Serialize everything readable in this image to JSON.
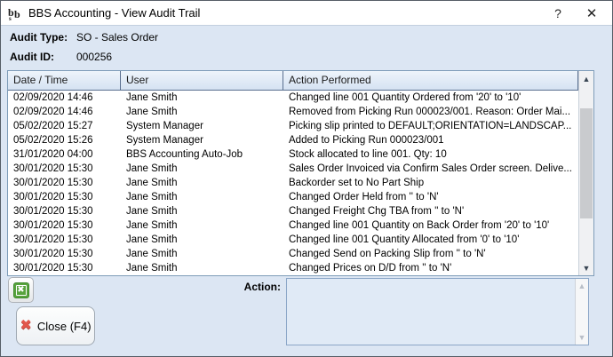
{
  "window": {
    "title": "BBS Accounting - View Audit Trail",
    "help_label": "?",
    "close_label": "✕"
  },
  "audit_info": {
    "type_label": "Audit Type:",
    "type_value": "SO - Sales Order",
    "id_label": "Audit ID:",
    "id_value": "000256"
  },
  "table": {
    "columns": [
      "Date / Time",
      "User",
      "Action Performed"
    ],
    "rows": [
      {
        "datetime": "02/09/2020 14:46",
        "user": "Jane Smith",
        "action": "Changed line 001 Quantity Ordered from '20' to '10'"
      },
      {
        "datetime": "02/09/2020 14:46",
        "user": "Jane Smith",
        "action": "Removed from Picking Run 000023/001. Reason: Order Mai..."
      },
      {
        "datetime": "05/02/2020 15:27",
        "user": "System Manager",
        "action": "Picking slip printed to DEFAULT;ORIENTATION=LANDSCAP..."
      },
      {
        "datetime": "05/02/2020 15:26",
        "user": "System Manager",
        "action": "Added to Picking Run 000023/001"
      },
      {
        "datetime": "31/01/2020 04:00",
        "user": "BBS Accounting Auto-Job",
        "action": "Stock allocated to line 001. Qty: 10"
      },
      {
        "datetime": "30/01/2020 15:30",
        "user": "Jane Smith",
        "action": "Sales Order Invoiced via Confirm Sales Order screen. Delive..."
      },
      {
        "datetime": "30/01/2020 15:30",
        "user": "Jane Smith",
        "action": "Backorder set to No Part Ship"
      },
      {
        "datetime": "30/01/2020 15:30",
        "user": "Jane Smith",
        "action": "Changed Order Held from '' to 'N'"
      },
      {
        "datetime": "30/01/2020 15:30",
        "user": "Jane Smith",
        "action": "Changed Freight Chg TBA from '' to 'N'"
      },
      {
        "datetime": "30/01/2020 15:30",
        "user": "Jane Smith",
        "action": "Changed line 001 Quantity on Back Order from '20' to '10'"
      },
      {
        "datetime": "30/01/2020 15:30",
        "user": "Jane Smith",
        "action": "Changed line 001 Quantity Allocated from '0' to '10'"
      },
      {
        "datetime": "30/01/2020 15:30",
        "user": "Jane Smith",
        "action": "Changed Send on Packing Slip from '' to 'N'"
      },
      {
        "datetime": "30/01/2020 15:30",
        "user": "Jane Smith",
        "action": "Changed Prices on D/D from '' to 'N'"
      }
    ]
  },
  "footer": {
    "action_label": "Action:",
    "action_value": "",
    "close_button_label": "Close (F4)",
    "close_icon_glyph": "✖",
    "export_icon": "excel-export-icon"
  },
  "scrollbar": {
    "up_glyph": "▲",
    "down_glyph": "▼"
  },
  "colors": {
    "dialog_bg": "#dce6f3",
    "titlebar_bg": "#ffffff",
    "table_border": "#7f9db9",
    "table_header_bg": "#d5e2f2",
    "close_x_red": "#e2574c",
    "excel_green": "#57a33e",
    "action_box_bg": "#e0eaf6"
  }
}
